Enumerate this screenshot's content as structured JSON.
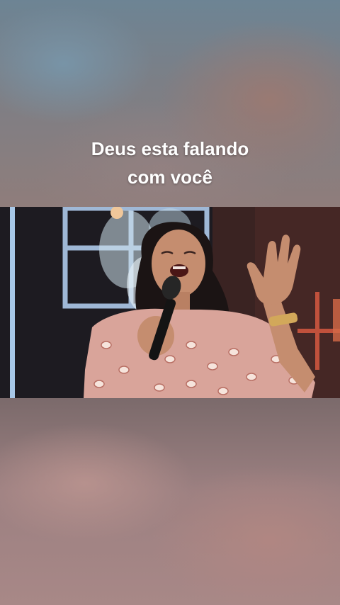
{
  "caption": {
    "line1": "Deus esta falando",
    "line2": "com você"
  },
  "colors": {
    "caption_text": "#ffffff",
    "blouse": "#d9a49a",
    "stage_background": "#1d1b21",
    "blur_top": "#7c7f86",
    "blur_bottom": "#9c8081"
  },
  "video": {
    "subject": "woman singing into microphone with raised hand"
  }
}
